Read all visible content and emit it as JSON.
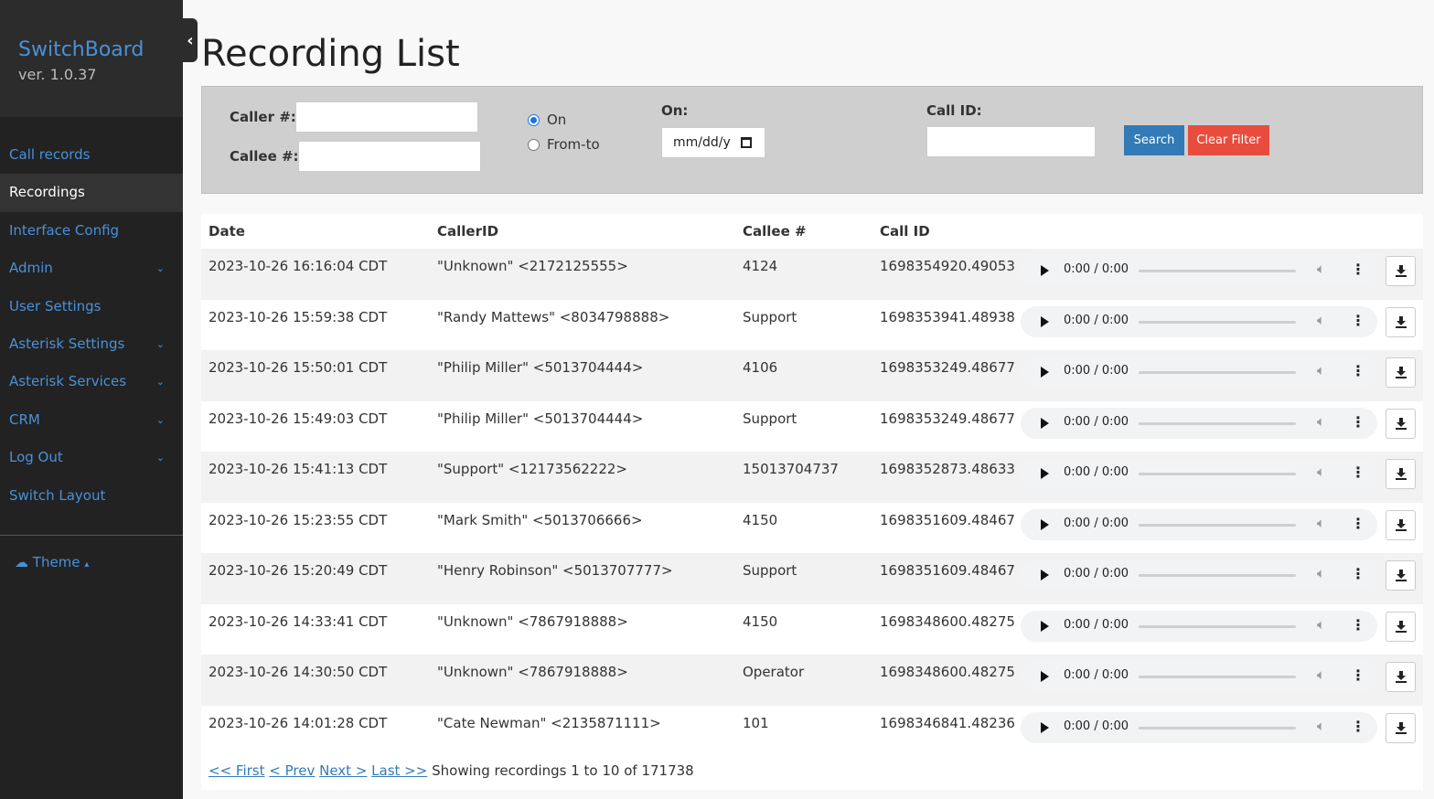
{
  "sidebar": {
    "brand": "SwitchBoard",
    "version": "ver. 1.0.37",
    "collapse_glyph": "‹",
    "items": [
      {
        "label": "Call records",
        "caret": ""
      },
      {
        "label": "Recordings",
        "caret": ""
      },
      {
        "label": "Interface Config",
        "caret": ""
      },
      {
        "label": "Admin",
        "caret": "⌄"
      },
      {
        "label": "User Settings",
        "caret": ""
      },
      {
        "label": "Asterisk Settings",
        "caret": "⌄"
      },
      {
        "label": "Asterisk Services",
        "caret": "⌄"
      },
      {
        "label": "CRM",
        "caret": "⌄"
      },
      {
        "label": "Log Out",
        "caret": "⌄"
      },
      {
        "label": "Switch Layout",
        "caret": ""
      }
    ],
    "theme_label": "Theme",
    "theme_glyph": "☁",
    "theme_caret": "▴"
  },
  "page": {
    "title": "Recording List"
  },
  "filter": {
    "caller_label": "Caller #:",
    "callee_label": "Callee #:",
    "radio_on": "On",
    "radio_from_to": "From-to",
    "on_label": "On:",
    "date_placeholder": "mm/dd/y",
    "callid_label": "Call ID:",
    "search_button": "Search",
    "clear_button": "Clear Filter"
  },
  "table": {
    "headers": [
      "Date",
      "CallerID",
      "Callee #",
      "Call ID"
    ],
    "player_time": "0:00 / 0:00",
    "rows": [
      {
        "date": "2023-10-26 16:16:04 CDT",
        "caller": "\"Unknown\" <2172125555>",
        "callee": "4124",
        "callid": "1698354920.49053"
      },
      {
        "date": "2023-10-26 15:59:38 CDT",
        "caller": "\"Randy Mattews\" <8034798888>",
        "callee": "Support",
        "callid": "1698353941.48938"
      },
      {
        "date": "2023-10-26 15:50:01 CDT",
        "caller": "\"Philip Miller\" <5013704444>",
        "callee": "4106",
        "callid": "1698353249.48677"
      },
      {
        "date": "2023-10-26 15:49:03 CDT",
        "caller": "\"Philip Miller\" <5013704444>",
        "callee": "Support",
        "callid": "1698353249.48677"
      },
      {
        "date": "2023-10-26 15:41:13 CDT",
        "caller": "\"Support\" <12173562222>",
        "callee": "15013704737",
        "callid": "1698352873.48633"
      },
      {
        "date": "2023-10-26 15:23:55 CDT",
        "caller": "\"Mark Smith\" <5013706666>",
        "callee": "4150",
        "callid": "1698351609.48467"
      },
      {
        "date": "2023-10-26 15:20:49 CDT",
        "caller": "\"Henry Robinson\" <5013707777>",
        "callee": "Support",
        "callid": "1698351609.48467"
      },
      {
        "date": "2023-10-26 14:33:41 CDT",
        "caller": "\"Unknown\" <7867918888>",
        "callee": "4150",
        "callid": "1698348600.48275"
      },
      {
        "date": "2023-10-26 14:30:50 CDT",
        "caller": "\"Unknown\" <7867918888>",
        "callee": "Operator",
        "callid": "1698348600.48275"
      },
      {
        "date": "2023-10-26 14:01:28 CDT",
        "caller": "\"Cate Newman\" <2135871111>",
        "callee": "101",
        "callid": "1698346841.48236"
      }
    ]
  },
  "pagination": {
    "first": "<< First",
    "prev": "< Prev",
    "next": "Next >",
    "last": "Last >>",
    "summary": "Showing recordings 1 to 10 of 171738"
  }
}
